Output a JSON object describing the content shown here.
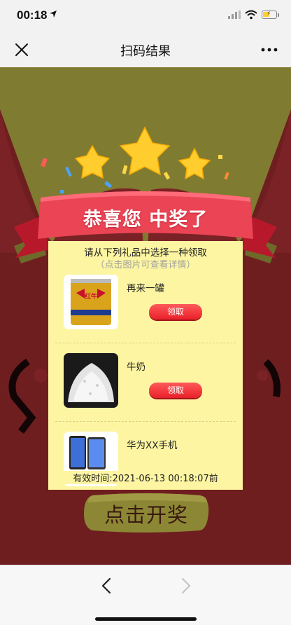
{
  "status_bar": {
    "time": "00:18",
    "icons": [
      "location-arrow-icon",
      "cellular-signal-icon",
      "wifi-icon",
      "battery-charging-icon"
    ],
    "battery_level": 0.55
  },
  "nav": {
    "title": "扫码结果",
    "left_icon": "close-icon",
    "right_icon": "more-icon"
  },
  "banner": {
    "headline": "恭喜您 中奖了"
  },
  "prize_panel": {
    "title": "请从下列礼品中选择一种领取",
    "subtitle": "（点击图片可查看详情）",
    "prizes": [
      {
        "name": "再来一罐",
        "claim_label": "领取",
        "image": "red-bull-can-photo"
      },
      {
        "name": "牛奶",
        "claim_label": "领取",
        "image": "milk-powder-photo"
      },
      {
        "name": "华为XX手机",
        "image": "smartphone-photo"
      }
    ],
    "expiry": "有效时间:2021-06-13 00:18:07前"
  },
  "open_button": {
    "label": "点击开奖"
  },
  "toolbar": {
    "back_icon": "chevron-left-icon",
    "forward_icon": "chevron-right-icon"
  },
  "colors": {
    "background_red": "#6f1e20",
    "olive": "#7f7b30",
    "ribbon_red": "#ea4455",
    "panel_yellow": "#fdf5a2",
    "claim_red": "#e8202a",
    "star_gold": "#ffcd2e"
  }
}
